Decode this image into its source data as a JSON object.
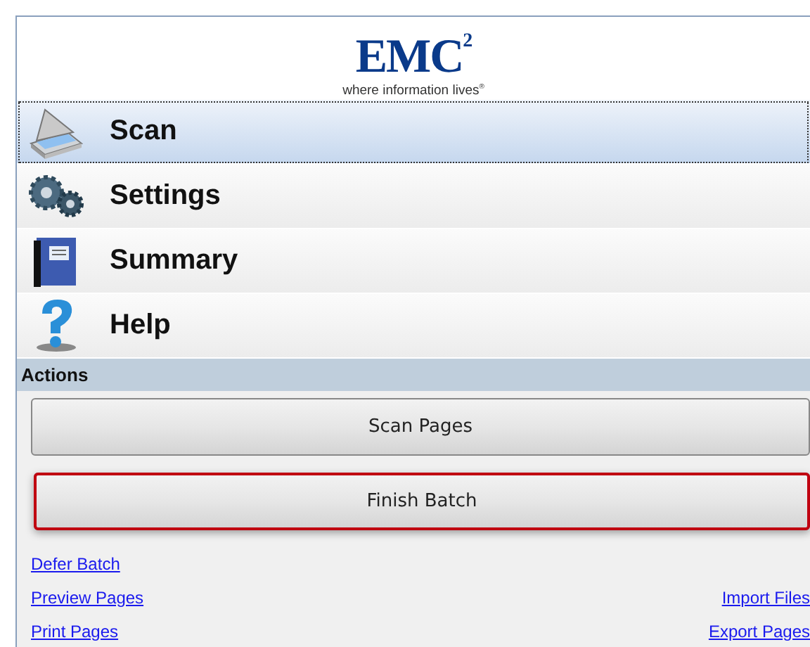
{
  "logo": {
    "brand": "EMC$^{2}$",
    "tagline": "where information lives$^{®}$"
  },
  "nav": [
    {
      "kind": "scan",
      "label": "Scan",
      "selected": true
    },
    {
      "kind": "settings",
      "label": "Settings",
      "selected": false
    },
    {
      "kind": "summary",
      "label": "Summary",
      "selected": false
    },
    {
      "kind": "help",
      "label": "Help",
      "selected": false
    }
  ],
  "actions": {
    "title": "Actions",
    "buttons": [
      {
        "label": "Scan Pages",
        "focused": false
      },
      {
        "label": "Finish Batch",
        "focused": true
      }
    ],
    "link_rows": [
      {
        "left": "Defer Batch"
      },
      {
        "left": "Preview Pages",
        "right": "Import Files"
      },
      {
        "left": "Print Pages",
        "right": "Export Pages"
      }
    ]
  }
}
